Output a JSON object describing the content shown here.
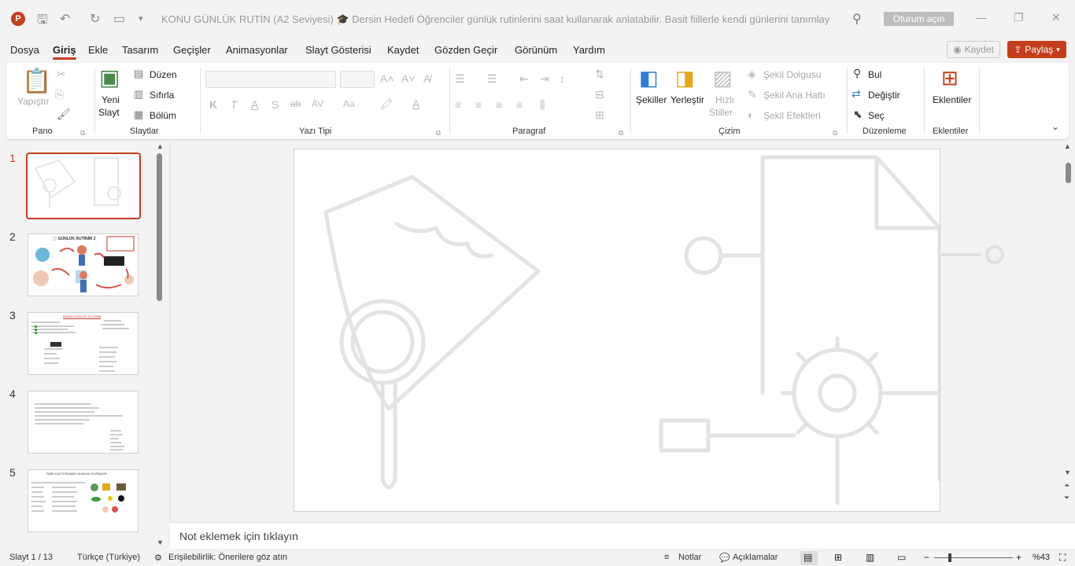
{
  "titlebar": {
    "app_letter": "P",
    "doc_title": "KONU GÜNLÜK RUTİN (A2 Seviyesi) 🎓 Dersin Hedefi Öğrenciler günlük rutinlerini saat kullanarak anlatabilir. Basit fiillerle kendi günlerini tanımlayabilirler...",
    "signin_label": "Oturum açın"
  },
  "menu": {
    "items": [
      "Dosya",
      "Giriş",
      "Ekle",
      "Tasarım",
      "Geçişler",
      "Animasyonlar",
      "Slayt Gösterisi",
      "Kaydet",
      "Gözden Geçir",
      "Görünüm",
      "Yardım"
    ],
    "active": "Giriş",
    "save_label": "Kaydet",
    "share_label": "Paylaş"
  },
  "ribbon": {
    "pano": {
      "label": "Pano",
      "paste": "Yapıştır"
    },
    "slaytlar": {
      "label": "Slaytlar",
      "new_slide_1": "Yeni",
      "new_slide_2": "Slayt",
      "layout": "Düzen",
      "reset": "Sıfırla",
      "section": "Bölüm"
    },
    "yazi_tipi": {
      "label": "Yazı Tipi",
      "bold": "K",
      "italic": "T",
      "underline": "A",
      "shadow": "S",
      "strike": "ab",
      "spacing": "AV",
      "case": "Aa"
    },
    "paragraf": {
      "label": "Paragraf"
    },
    "cizim": {
      "label": "Çizim",
      "shapes": "Şekiller",
      "arrange": "Yerleştir",
      "quick_1": "Hızlı",
      "quick_2": "Stiller",
      "fill": "Şekil Dolgusu",
      "outline": "Şekil Ana Hattı",
      "effects": "Şekil Efektleri"
    },
    "duzenleme": {
      "label": "Düzenleme",
      "find": "Bul",
      "replace": "Değiştir",
      "select": "Seç"
    },
    "eklentiler": {
      "label": "Eklentiler",
      "addins": "Eklentiler"
    }
  },
  "slides": {
    "numbers": [
      "1",
      "2",
      "3",
      "4",
      "5"
    ],
    "thumb2_title": "🕐 GÜNLÜK RUTİNİM 2",
    "thumb3_title": "BENİM GÜNLÜK RUTİNİM",
    "thumb5_title": "TÜRK KÜLTÜRÜNDE GÜNLÜK RUTİNLER"
  },
  "notes": {
    "placeholder": "Not eklemek için tıklayın"
  },
  "status": {
    "slide_info": "Slayt 1 / 13",
    "language": "Türkçe (Türkiye)",
    "accessibility": "Erişilebilirlik: Önerilere göz atın",
    "notes": "Notlar",
    "comments": "Açıklamalar",
    "zoom": "%43"
  },
  "colors": {
    "accent": "#c43e1c"
  }
}
